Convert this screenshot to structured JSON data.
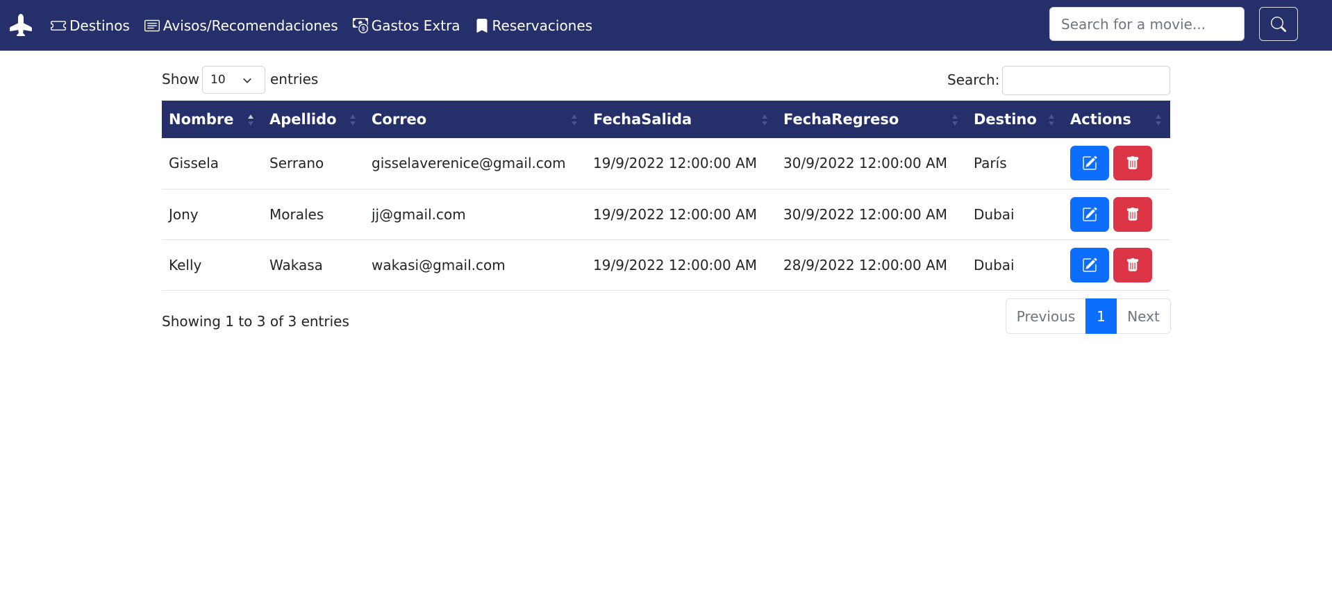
{
  "navbar": {
    "brand_icon": "airplane-icon",
    "items": [
      {
        "label": "Destinos",
        "icon": "ticket-icon"
      },
      {
        "label": "Avisos/Recomendaciones",
        "icon": "card-text-icon"
      },
      {
        "label": "Gastos Extra",
        "icon": "cash-coin-icon"
      },
      {
        "label": "Reservaciones",
        "icon": "bookmark-icon"
      }
    ],
    "search_placeholder": "Search for a movie...",
    "search_button_icon": "search-icon"
  },
  "controls": {
    "show_label": "Show",
    "page_length": "10",
    "entries_label": "entries",
    "search_label": "Search:",
    "search_value": ""
  },
  "table": {
    "columns": [
      "Nombre",
      "Apellido",
      "Correo",
      "FechaSalida",
      "FechaRegreso",
      "Destino",
      "Actions"
    ],
    "sorted_column": "Nombre",
    "rows": [
      {
        "nombre": "Gissela",
        "apellido": "Serrano",
        "correo": "gisselaverenice@gmail.com",
        "fecha_salida": "19/9/2022 12:00:00 AM",
        "fecha_regreso": "30/9/2022 12:00:00 AM",
        "destino": "París"
      },
      {
        "nombre": "Jony",
        "apellido": "Morales",
        "correo": "jj@gmail.com",
        "fecha_salida": "19/9/2022 12:00:00 AM",
        "fecha_regreso": "30/9/2022 12:00:00 AM",
        "destino": "Dubai"
      },
      {
        "nombre": "Kelly",
        "apellido": "Wakasa",
        "correo": "wakasi@gmail.com",
        "fecha_salida": "19/9/2022 12:00:00 AM",
        "fecha_regreso": "28/9/2022 12:00:00 AM",
        "destino": "Dubai"
      }
    ]
  },
  "footer": {
    "info": "Showing 1 to 3 of 3 entries",
    "pagination": {
      "previous": "Previous",
      "current": "1",
      "next": "Next"
    }
  },
  "colors": {
    "navbar": "#25306b",
    "edit_button": "#0d6efd",
    "delete_button": "#dc3545",
    "active_page": "#0d6efd"
  }
}
